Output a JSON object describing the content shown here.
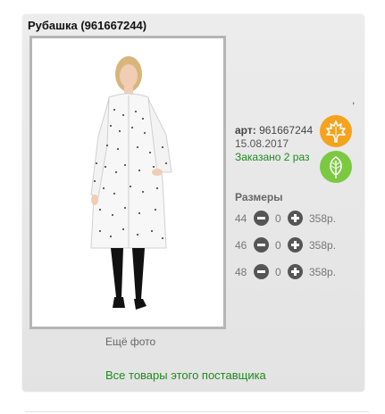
{
  "product": {
    "title": "Рубашка (961667244)",
    "comma": ",",
    "art_label": "арт:",
    "art_value": "961667244",
    "date": "15.08.2017",
    "ordered": "Заказано 2 раз",
    "more_photo": "Ещё фото",
    "supplier_link": "Все товары этого поставщика"
  },
  "sizes": {
    "title": "Размеры",
    "rows": [
      {
        "size": "44",
        "qty": "0",
        "price": "358р."
      },
      {
        "size": "46",
        "qty": "0",
        "price": "358р."
      },
      {
        "size": "48",
        "qty": "0",
        "price": "358р."
      }
    ]
  },
  "colors": {
    "accent_green": "#1d8b1d",
    "badge_orange": "#f5a21e",
    "badge_green": "#7bc940"
  },
  "icons": {
    "badge_1": "maple-leaf-icon",
    "badge_2": "leaf-icon",
    "minus": "minus-circle-icon",
    "plus": "plus-circle-icon"
  }
}
